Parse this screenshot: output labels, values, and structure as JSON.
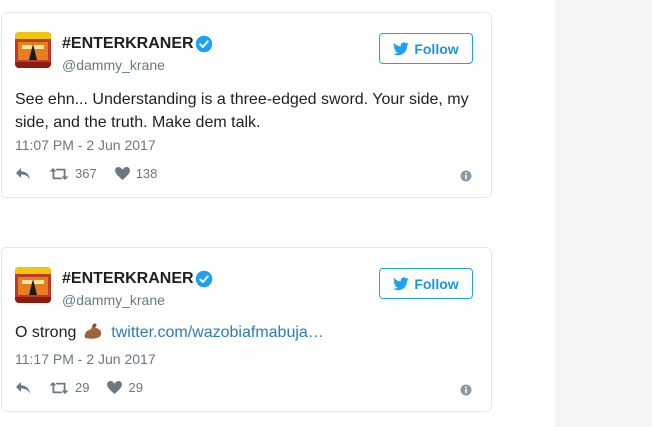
{
  "tweets": [
    {
      "display_name": "#ENTERKRANER",
      "handle": "@dammy_krane",
      "follow_label": "Follow",
      "text": "See ehn... Understanding is a three-edged sword. Your side, my side, and the truth. Make dem talk.",
      "timestamp": "11:07 PM - 2 Jun 2017",
      "retweets": "367",
      "likes": "138"
    },
    {
      "display_name": "#ENTERKRANER",
      "handle": "@dammy_krane",
      "follow_label": "Follow",
      "text": "O strong",
      "emoji": "flexed-biceps",
      "link": "twitter.com/wazobiafmabuja…",
      "timestamp": "11:17 PM - 2 Jun 2017",
      "retweets": "29",
      "likes": "29"
    }
  ],
  "colors": {
    "twitter_blue": "#1da1f2",
    "link_blue": "#2b7bb9",
    "meta_gray": "#697882",
    "text_dark": "#1c2022",
    "border": "#e1e8ed",
    "rail_bg": "#f5f5f5"
  },
  "icons": [
    "avatar",
    "verified-badge-icon",
    "twitter-bird-icon",
    "reply-icon",
    "retweet-icon",
    "heart-icon",
    "info-icon"
  ]
}
